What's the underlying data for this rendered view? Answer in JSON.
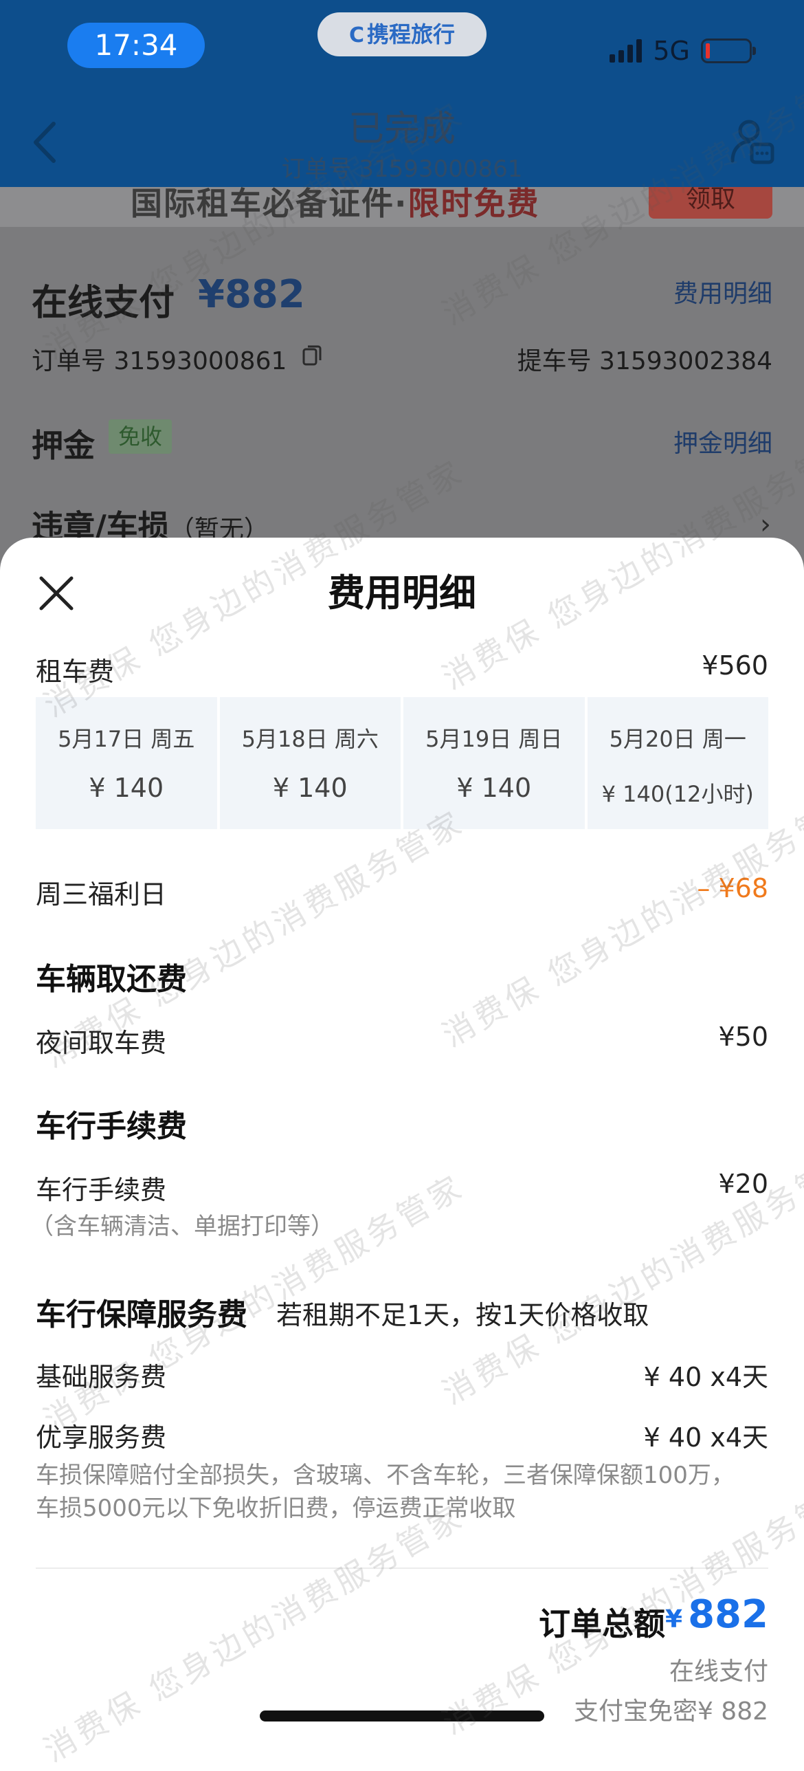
{
  "status_bar": {
    "time": "17:34",
    "brand": "携程旅行",
    "brand_logo": "C",
    "network": "5G",
    "battery_color": "#e8322c"
  },
  "nav": {
    "title": "已完成",
    "order_no": "订单号 31593000861"
  },
  "background": {
    "banner_text": "国际租车必备证件·",
    "banner_highlight": "限时免费",
    "banner_button": "领取",
    "pay_title": "在线支付",
    "pay_amount": "¥882",
    "fee_detail_link": "费用明细",
    "order_line": "订单号   31593000861",
    "pickup_line": "提车号   31593002384",
    "deposit_title": "押金",
    "deposit_badge": "免收",
    "deposit_link": "押金明细",
    "violation_title": "违章/车损",
    "violation_sub": "（暂无）"
  },
  "sheet": {
    "title": "费用明细",
    "rental": {
      "label": "租车费",
      "value": "¥560"
    },
    "days": [
      {
        "date": "5月17日 周五",
        "price": "¥ 140"
      },
      {
        "date": "5月18日 周六",
        "price": "¥ 140"
      },
      {
        "date": "5月19日 周日",
        "price": "¥ 140"
      },
      {
        "date": "5月20日 周一",
        "price": "¥ 140(12小时)"
      }
    ],
    "discount": {
      "label": "周三福利日",
      "value": "– ¥68",
      "color": "#f07a1c"
    },
    "pickup_section": "车辆取还费",
    "night_fee": {
      "label": "夜间取车费",
      "value": "¥50"
    },
    "handling_section": "车行手续费",
    "handling_fee": {
      "label": "车行手续费",
      "value": "¥20",
      "note": "（含车辆清洁、单据打印等）"
    },
    "protection_section": "车行保障服务费",
    "protection_note": "若租期不足1天，按1天价格收取",
    "basic_service": {
      "label": "基础服务费",
      "value": "¥ 40 x4天"
    },
    "premium_service": {
      "label": "优享服务费",
      "value": "¥ 40 x4天",
      "note": "车损保障赔付全部损失，含玻璃、不含车轮，三者保障保额100万，车损5000元以下免收折旧费，停运费正常收取"
    },
    "total": {
      "label": "订单总额",
      "currency": "¥",
      "amount": "882",
      "color": "#1a70e8"
    },
    "pay_method": "在线支付",
    "pay_detail": "支付宝免密¥ 882"
  },
  "watermark": "消费保 您身边的消费服务管家"
}
